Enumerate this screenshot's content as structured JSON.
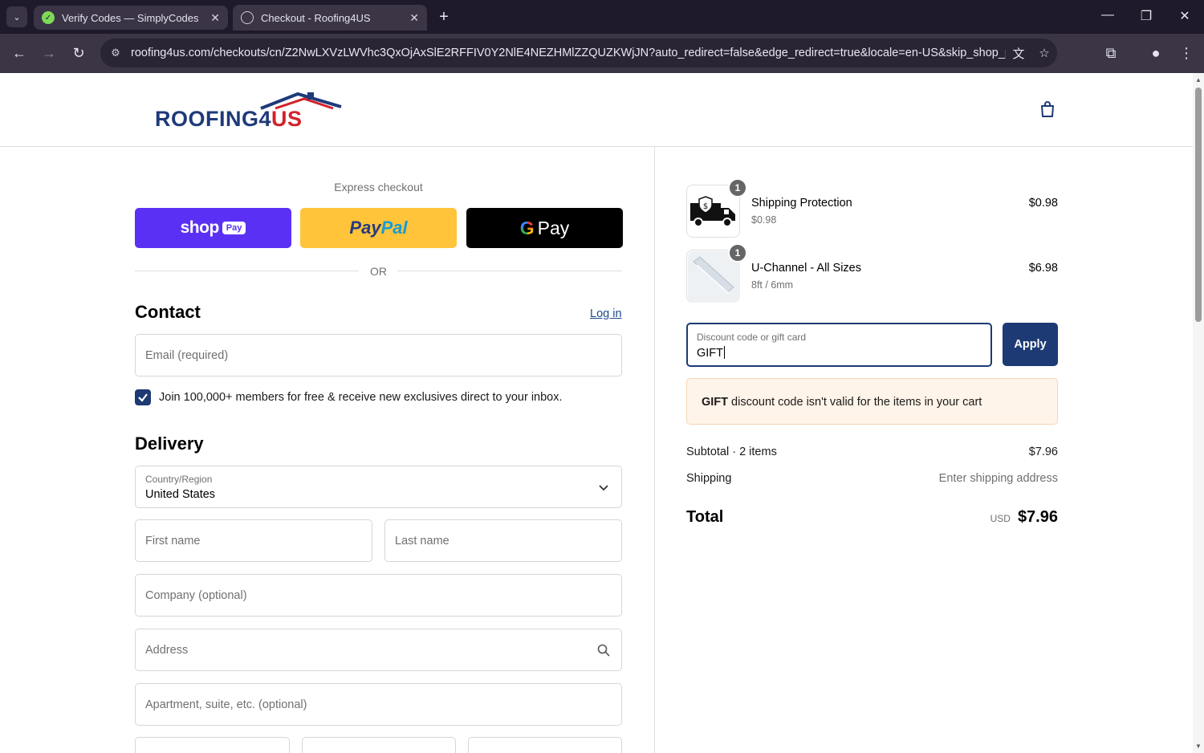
{
  "browser": {
    "tabs": [
      {
        "title": "Verify Codes — SimplyCodes",
        "active": false
      },
      {
        "title": "Checkout - Roofing4US",
        "active": true
      }
    ],
    "url": "roofing4us.com/checkouts/cn/Z2NwLXVzLWVhc3QxOjAxSlE2RFFIV0Y2NlE4NEZHMlZZQUZKWjJN?auto_redirect=false&edge_redirect=true&locale=en-US&skip_shop_pay=..."
  },
  "header": {
    "logo_text_main": "ROOFING4",
    "logo_text_accent": "US"
  },
  "express": {
    "label": "Express checkout",
    "shop_pay_word": "shop",
    "shop_pay_pill": "Pay",
    "paypal_a": "Pay",
    "paypal_b": "Pal",
    "gpay_g": "G",
    "gpay_word": "Pay",
    "or_text": "OR"
  },
  "contact": {
    "heading": "Contact",
    "login_link": "Log in",
    "email_placeholder": "Email (required)",
    "newsletter_label": "Join 100,000+ members for free & receive new exclusives direct to your inbox.",
    "newsletter_checked": true
  },
  "delivery": {
    "heading": "Delivery",
    "country_label": "Country/Region",
    "country_value": "United States",
    "first_name_placeholder": "First name",
    "last_name_placeholder": "Last name",
    "company_placeholder": "Company (optional)",
    "address_placeholder": "Address",
    "apartment_placeholder": "Apartment, suite, etc. (optional)"
  },
  "order": {
    "items": [
      {
        "name": "Shipping Protection",
        "variant": "$0.98",
        "price": "$0.98",
        "qty": "1"
      },
      {
        "name": "U-Channel - All Sizes",
        "variant": "8ft / 6mm",
        "price": "$6.98",
        "qty": "1"
      }
    ],
    "discount_label": "Discount code or gift card",
    "discount_value": "GIFT",
    "apply_label": "Apply",
    "notice_code": "GIFT",
    "notice_text": " discount code isn't valid for the items in your cart",
    "subtotal_label": "Subtotal · 2 items",
    "subtotal_value": "$7.96",
    "shipping_label": "Shipping",
    "shipping_value": "Enter shipping address",
    "total_label": "Total",
    "total_currency": "USD",
    "total_value": "$7.96"
  },
  "colors": {
    "accent": "#1d3a74",
    "shop_pay": "#5a31f4",
    "paypal": "#ffc439",
    "notice_bg": "#fff4e9"
  }
}
